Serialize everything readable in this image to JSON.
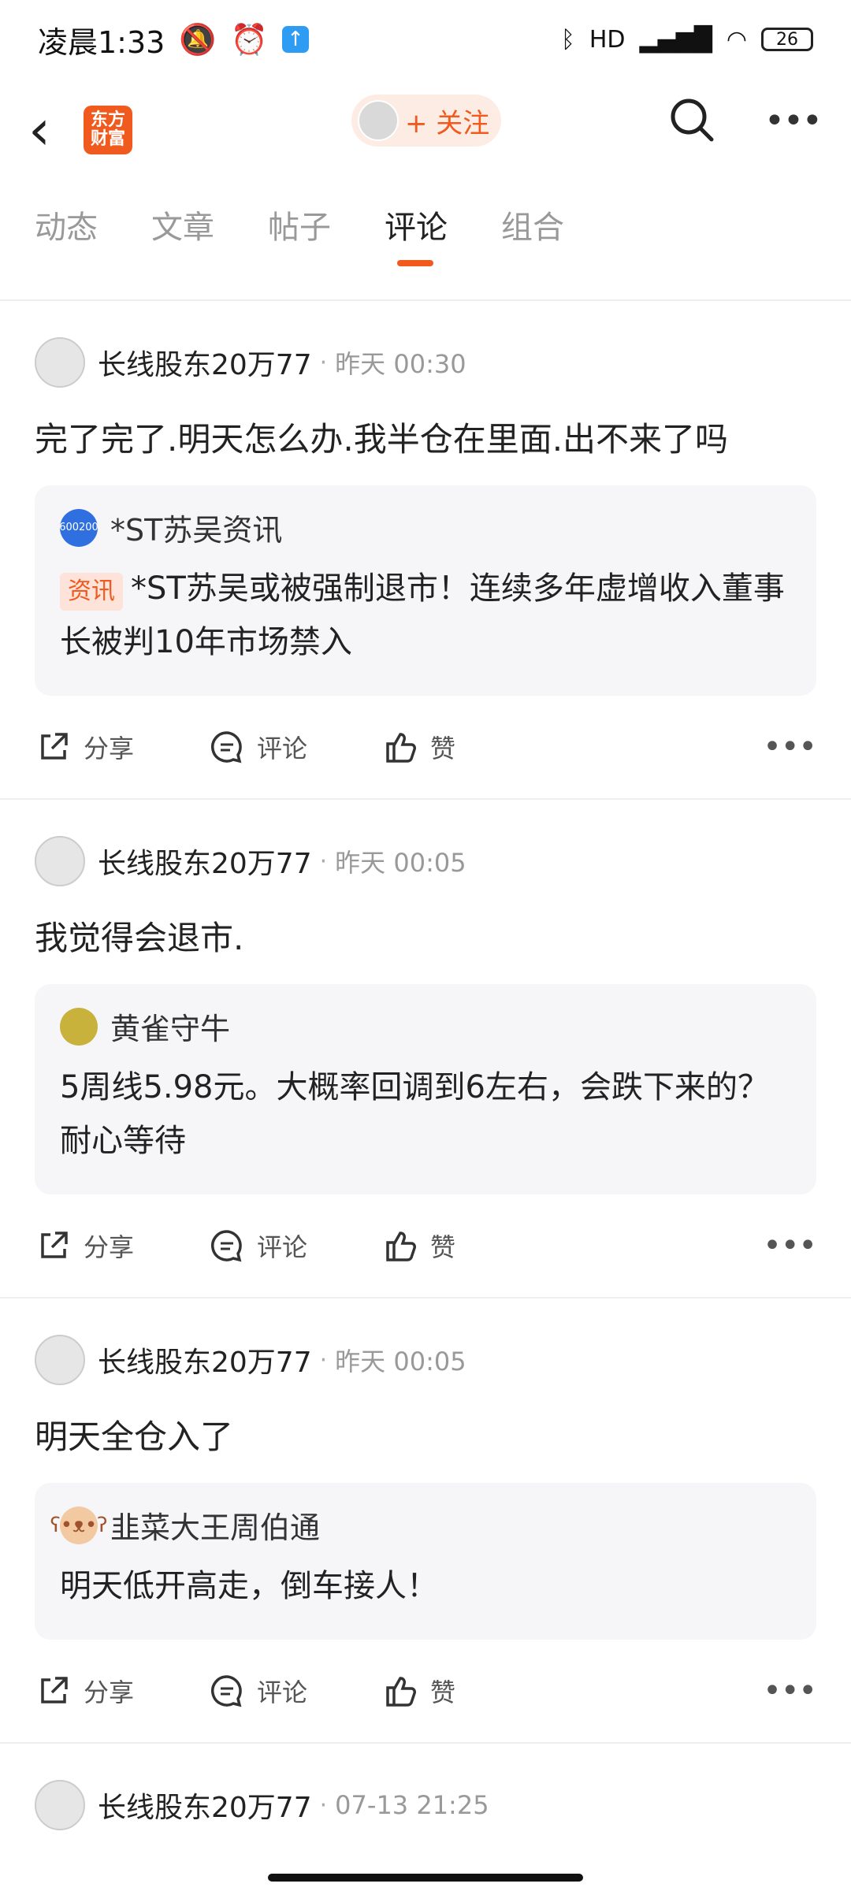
{
  "status": {
    "time": "凌晨1:33",
    "network": "HD",
    "battery": "26"
  },
  "header": {
    "brand_logo_text": "东方财富",
    "follow_label": "+ 关注"
  },
  "tabs": [
    {
      "label": "动态"
    },
    {
      "label": "文章"
    },
    {
      "label": "帖子"
    },
    {
      "label": "评论",
      "active": true
    },
    {
      "label": "组合"
    }
  ],
  "posts": [
    {
      "author": "长线股东20万77",
      "time": "昨天 00:30",
      "text": "完了完了.明天怎么办.我半仓在里面.出不来了吗",
      "quote": {
        "icon_text": "600200",
        "author": "*ST苏吴资讯",
        "tag": "资讯",
        "text": "*ST苏吴或被强制退市！连续多年虚增收入董事长被判10年市场禁入"
      }
    },
    {
      "author": "长线股东20万77",
      "time": "昨天 00:05",
      "text": "我觉得会退市.",
      "quote": {
        "author": "黄雀守牛",
        "text": "5周线5.98元。大概率回调到6左右，会跌下来的？耐心等待"
      }
    },
    {
      "author": "长线股东20万77",
      "time": "昨天 00:05",
      "text": "明天全仓入了",
      "quote": {
        "author": "韭菜大王周伯通",
        "text": "明天低开高走，倒车接人！"
      }
    },
    {
      "author": "长线股东20万77",
      "time": "07-13 21:25"
    }
  ],
  "actions": {
    "share": "分享",
    "comment": "评论",
    "like": "赞"
  }
}
